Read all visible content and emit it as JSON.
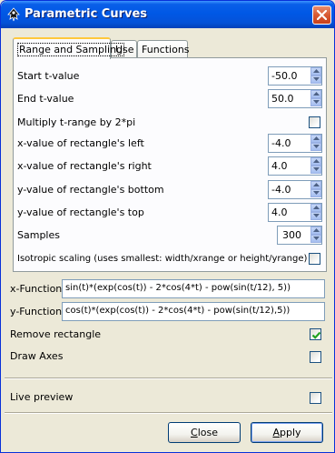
{
  "window": {
    "title": "Parametric Curves",
    "title_icon": "inkscape-logo-icon",
    "close_icon": "close-x-icon"
  },
  "tabs": [
    {
      "label": "Range and Sampling",
      "active": true
    },
    {
      "label": "Use",
      "active": false
    },
    {
      "label": "Functions",
      "active": false
    }
  ],
  "range": {
    "start_t": {
      "label": "Start t-value",
      "value": "-50.0"
    },
    "end_t": {
      "label": "End t-value",
      "value": "50.0"
    },
    "multiply_pi": {
      "label": "Multiply t-range by 2*pi",
      "checked": false
    },
    "x_left": {
      "label": "x-value of rectangle's left",
      "value": "-4.0"
    },
    "x_right": {
      "label": "x-value of rectangle's right",
      "value": "4.0"
    },
    "y_bottom": {
      "label": "y-value of rectangle's bottom",
      "value": "-4.0"
    },
    "y_top": {
      "label": "y-value of rectangle's top",
      "value": "4.0"
    },
    "samples": {
      "label": "Samples",
      "value": "300"
    },
    "isotropic": {
      "label": "Isotropic scaling (uses smallest: width/xrange or height/yrange)",
      "checked": false
    }
  },
  "functions": {
    "x": {
      "label": "x-Function",
      "value": "sin(t)*(exp(cos(t)) - 2*cos(4*t) - pow(sin(t/12), 5))"
    },
    "y": {
      "label": "y-Function",
      "value": "cos(t)*(exp(cos(t)) - 2*cos(4*t) - pow(sin(t/12),5))"
    }
  },
  "options": {
    "remove_rectangle": {
      "label": "Remove rectangle",
      "checked": true
    },
    "draw_axes": {
      "label": "Draw Axes",
      "checked": false
    },
    "live_preview": {
      "label": "Live preview",
      "checked": false
    }
  },
  "buttons": {
    "close": {
      "mnemonic": "C",
      "rest": "lose"
    },
    "apply": {
      "mnemonic": "A",
      "rest": "pply"
    }
  },
  "colors": {
    "titlebar": "#0058e6",
    "tab_highlight": "#ffc83c",
    "check_mark": "#21a121"
  }
}
